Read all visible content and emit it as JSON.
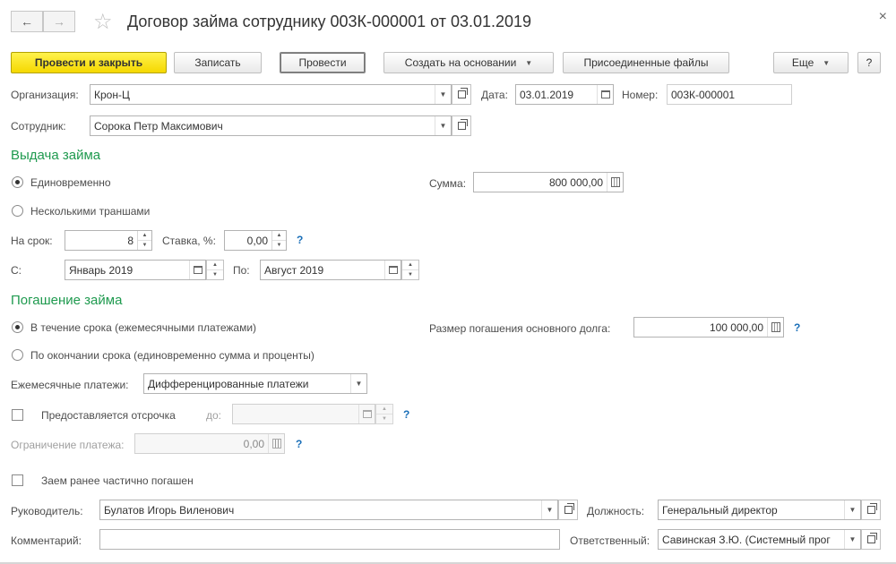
{
  "window": {
    "title": "Договор займа сотруднику 003К-000001 от 03.01.2019",
    "close_label": "×"
  },
  "nav": {
    "back": "←",
    "forward": "→",
    "favorite": "☆"
  },
  "toolbar": {
    "post_and_close": "Провести и закрыть",
    "save": "Записать",
    "post": "Провести",
    "create_based_on": "Создать на основании",
    "attached_files": "Присоединенные файлы",
    "more": "Еще",
    "help": "?"
  },
  "header": {
    "organization_label": "Организация:",
    "organization_value": "Крон-Ц",
    "date_label": "Дата:",
    "date_value": "03.01.2019",
    "number_label": "Номер:",
    "number_value": "003К-000001",
    "employee_label": "Сотрудник:",
    "employee_value": "Сорока Петр Максимович"
  },
  "issue": {
    "section_title": "Выдача займа",
    "once_label": "Единовременно",
    "tranches_label": "Несколькими траншами",
    "selected": "once",
    "amount_label": "Сумма:",
    "amount_value": "800 000,00",
    "term_label": "На срок:",
    "term_value": "8",
    "rate_label": "Ставка, %:",
    "rate_value": "0,00",
    "from_label": "С:",
    "from_value": "Январь 2019",
    "to_label": "По:",
    "to_value": "Август 2019"
  },
  "repay": {
    "section_title": "Погашение займа",
    "during_label": "В течение срока (ежемесячными платежами)",
    "end_label": "По окончании срока (единовременно сумма и проценты)",
    "selected": "during",
    "principal_label": "Размер погашения основного долга:",
    "principal_value": "100 000,00",
    "monthly_label": "Ежемесячные платежи:",
    "monthly_value": "Дифференцированные платежи",
    "deferral_label": "Предоставляется отсрочка",
    "deferral_until_label": "до:",
    "deferral_until_value": "",
    "limit_label": "Ограничение платежа:",
    "limit_value": "0,00",
    "partially_repaid_label": "Заем ранее частично погашен"
  },
  "footer": {
    "head_label": "Руководитель:",
    "head_value": "Булатов Игорь Виленович",
    "position_label": "Должность:",
    "position_value": "Генеральный директор",
    "comment_label": "Комментарий:",
    "comment_value": "",
    "responsible_label": "Ответственный:",
    "responsible_value": "Савинская З.Ю. (Системный прог"
  },
  "icons": {
    "help_mark": "?"
  },
  "colors": {
    "section": "#1f9a4f",
    "primary_button": "#f5d800",
    "help": "#1a6fb8"
  }
}
